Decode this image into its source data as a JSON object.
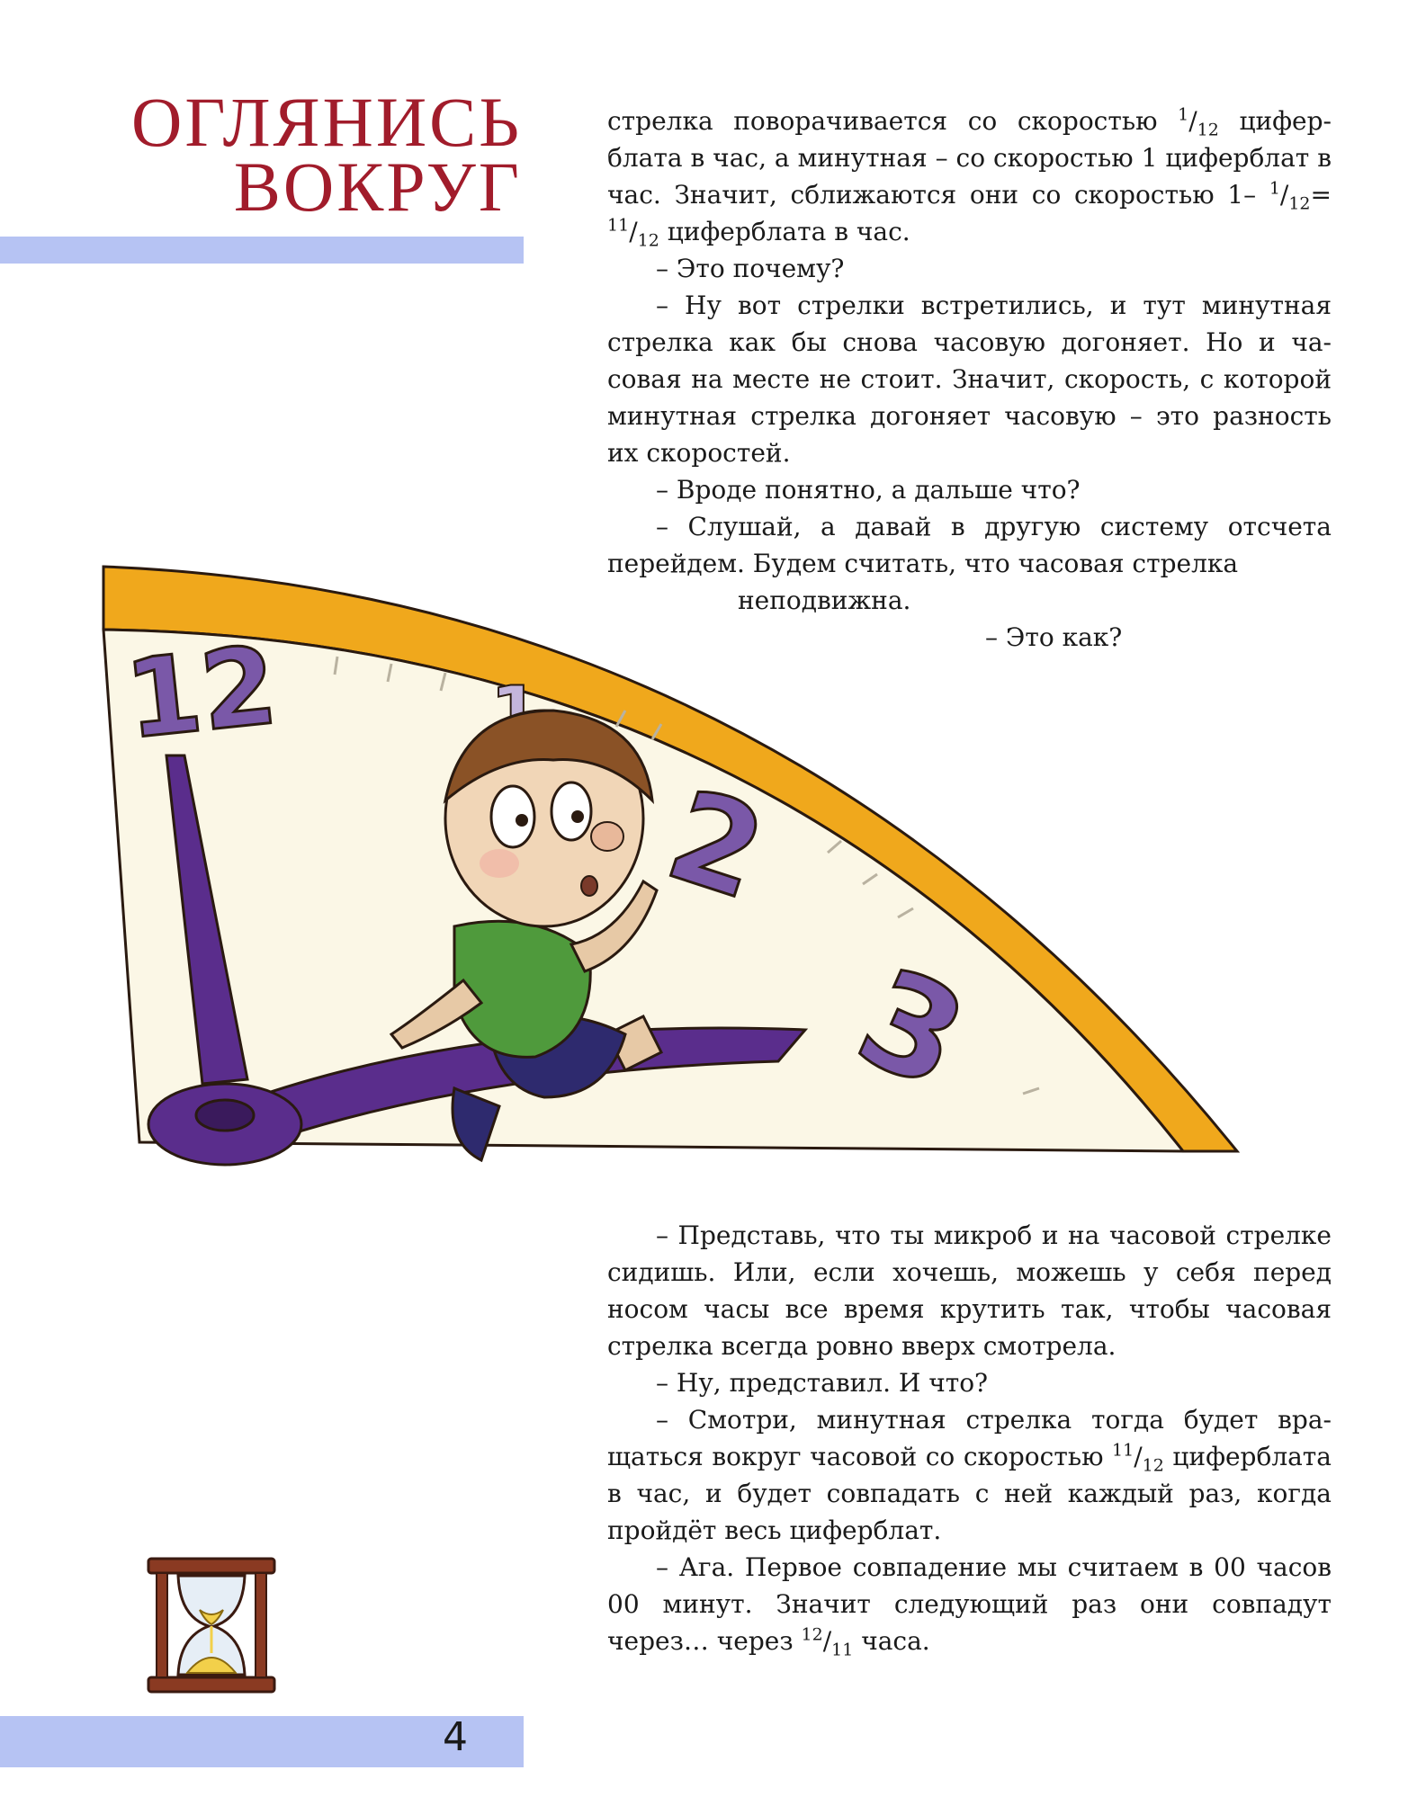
{
  "title": {
    "line1": "ОГЛЯНИСЬ",
    "line2": "ВОКРУГ"
  },
  "page_number": "4",
  "text_top": {
    "p1_a": "стрелка поворачивается со скоростью ",
    "f1_num": "1",
    "f1_den": "12",
    "p1_b": " цифер­блата в час, а минутная – со скоростью 1 цифер­блат в час. Значит, сближаются они со скоростью 1– ",
    "f2_num": "1",
    "f2_den": "12",
    "p1_c": "= ",
    "f3_num": "11",
    "f3_den": "12",
    "p1_d": " циферблата в час.",
    "p2": "– Это почему?",
    "p3": "– Ну вот стрелки встретились, и тут минутная стрелка как бы снова часовую догоняет. Но и ча­совая на месте не стоит. Значит, скорость, с ко­торой минутная стрелка догоняет часовую – это разность их скоростей.",
    "p4": "– Вроде понятно, а дальше что?",
    "p5_a": "– Слушай, а давай в другую систему отсчета перейдем. Будем считать, что часовая стрелка",
    "p5_b": "неподвижна.",
    "p6": "– Это как?"
  },
  "text_bottom": {
    "p1": "– Представь, что ты микроб и на часовой стрел­ке сидишь. Или, если хочешь, можешь у себя пе­ред носом часы все время крутить так, чтобы ча­совая стрелка всегда ровно вверх смотрела.",
    "p2": "– Ну, представил. И что?",
    "p3_a": "– Смотри, минутная стрелка тогда будет вра­щаться вокруг часовой со скоростью ",
    "f4_num": "11",
    "f4_den": "12",
    "p3_b": " цифер­блата в час, и будет совпадать с ней каждый раз, когда пройдёт весь циферблат.",
    "p4_a": "– Ага. Первое совпадение мы считаем в 00 ча­сов 00 минут. Значит следующий раз они совпа­дут через… через ",
    "f5_num": "12",
    "f5_den": "11",
    "p4_b": " часа."
  },
  "illustration": {
    "numerals": [
      "12",
      "1",
      "2",
      "3"
    ],
    "colors": {
      "rim": "#f0a81c",
      "face": "#fbf7e6",
      "numerals": "#7a58a8",
      "hand": "#5a2d8c",
      "shirt": "#4f9a3c",
      "hair": "#8a5226"
    }
  },
  "colors": {
    "title": "#a11c2b",
    "band": "#b6c3f3"
  }
}
